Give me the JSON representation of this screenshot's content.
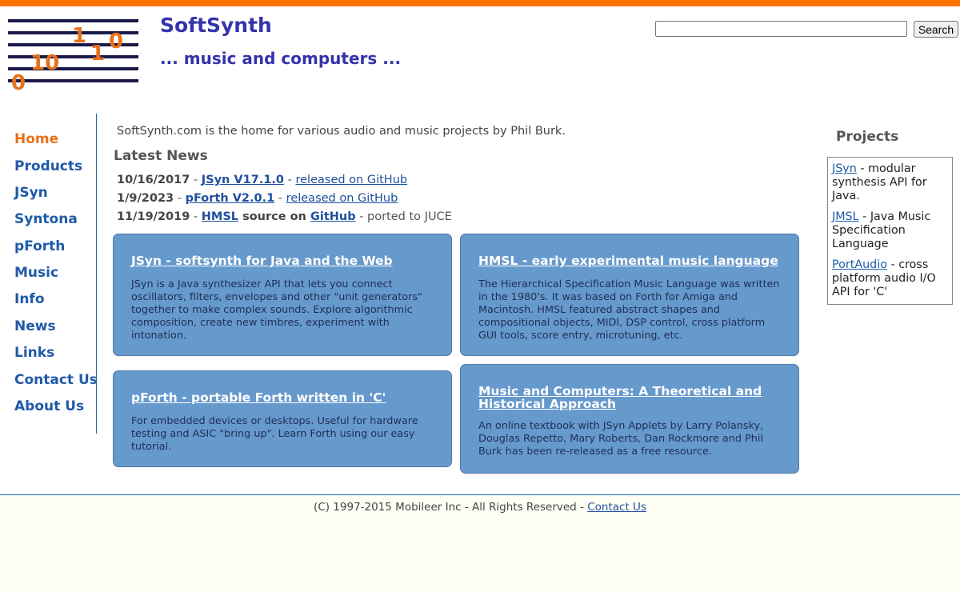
{
  "header": {
    "logo_digits": [
      "1",
      "1",
      "0",
      "10",
      "0"
    ],
    "title": "SoftSynth",
    "tagline": "... music and computers ...",
    "search_placeholder": "",
    "search_button": "Search"
  },
  "nav": {
    "items": [
      {
        "label": "Home",
        "active": true
      },
      {
        "label": "Products"
      },
      {
        "label": "JSyn"
      },
      {
        "label": "Syntona"
      },
      {
        "label": "pForth"
      },
      {
        "label": "Music"
      },
      {
        "label": "Info"
      },
      {
        "label": "News"
      },
      {
        "label": "Links"
      },
      {
        "label": "Contact Us"
      },
      {
        "label": "About Us"
      }
    ]
  },
  "main": {
    "intro": "SoftSynth.com is the home for various audio and music projects by Phil Burk.",
    "latest_heading": "Latest News",
    "news": [
      {
        "date": "10/16/2017",
        "sep1": " - ",
        "link1": "JSyn V17.1.0",
        "sep2": " - ",
        "link2": "released on GitHub"
      },
      {
        "date": "1/9/2023",
        "sep1": " - ",
        "link1": "pForth V2.0.1",
        "sep2": " - ",
        "link2": "released on GitHub"
      },
      {
        "date": "11/19/2019",
        "sep1": " - ",
        "link1": "HMSL",
        "text1": " source on ",
        "link2": "GitHub",
        "text2": " - ported to JUCE"
      }
    ],
    "cards": [
      {
        "title": "JSyn - softsynth for Java and the Web",
        "description": "JSyn is a Java synthesizer API that lets you connect oscillators, filters, envelopes and other \"unit generators\" together to make complex sounds. Explore algorithmic composition, create new timbres, experiment with intonation."
      },
      {
        "title": "HMSL - early experimental music language",
        "description": "The Hierarchical Specification Music Language was written in the 1980's. It was based on Forth for Amiga and Macintosh. HMSL featured abstract shapes and compositional objects, MIDI, DSP control, cross platform GUI tools, score entry, microtuning, etc."
      },
      {
        "title": "pForth - portable Forth written in 'C'",
        "description": "For embedded devices or desktops. Useful for hardware testing and ASIC \"bring up\". Learn Forth using our easy tutorial."
      },
      {
        "title": "Music and Computers: A Theoretical and Historical Approach",
        "description": "An online textbook with JSyn Applets by Larry Polansky, Douglas Repetto, Mary Roberts, Dan Rockmore and Phil Burk has been re-released as a free resource."
      }
    ]
  },
  "projects": {
    "heading": "Projects",
    "items": [
      {
        "link": "JSyn",
        "text": " - modular synthesis API for Java."
      },
      {
        "link": "JMSL",
        "text": " - Java Music Specification Language"
      },
      {
        "link": "PortAudio",
        "text": " - cross platform audio I/O API for 'C'"
      }
    ]
  },
  "footer": {
    "copyright": "(C) 1997-2015 Mobileer Inc - All Rights Reserved - ",
    "contact_link": "Contact Us"
  },
  "colors": {
    "accent_orange": "#ff7300",
    "title_blue": "#3333aa",
    "nav_blue": "#1f5aa8",
    "card_blue": "#6699cc"
  }
}
